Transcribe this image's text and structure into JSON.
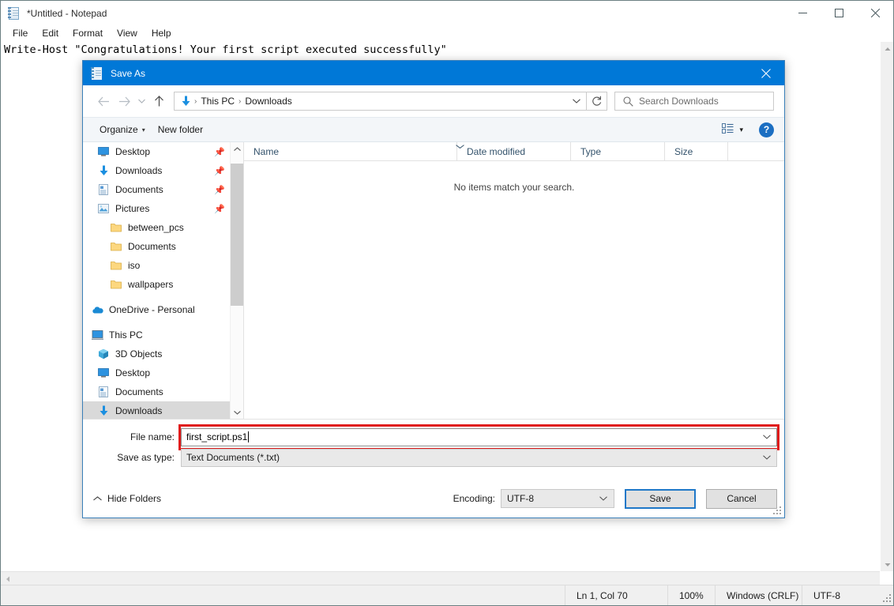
{
  "notepad": {
    "title": "*Untitled - Notepad",
    "icon": "notepad-icon",
    "window_controls": {
      "minimize": "minimize-icon",
      "maximize": "maximize-icon",
      "close": "close-icon"
    },
    "menu": [
      {
        "label": "File"
      },
      {
        "label": "Edit"
      },
      {
        "label": "Format"
      },
      {
        "label": "View"
      },
      {
        "label": "Help"
      }
    ],
    "document_text": "Write-Host \"Congratulations! Your first script executed successfully\"",
    "statusbar": {
      "position": "Ln 1, Col 70",
      "zoom": "100%",
      "line_endings": "Windows (CRLF)",
      "encoding": "UTF-8"
    }
  },
  "dialog": {
    "title": "Save As",
    "title_icon": "notepad-icon",
    "close_label": "✕",
    "nav": {
      "back": "back-arrow-icon",
      "forward": "forward-arrow-icon",
      "recent": "chevron-down-icon",
      "up": "up-arrow-icon",
      "address_icon": "downloads-arrow-icon",
      "breadcrumbs": [
        "This PC",
        "Downloads"
      ],
      "separator": "›",
      "dropdown": "chevron-down-icon",
      "refresh": "refresh-icon",
      "search_icon": "search-icon",
      "search_placeholder": "Search Downloads"
    },
    "toolbar": {
      "organize": "Organize",
      "organize_caret": "▾",
      "new_folder": "New folder",
      "view_icon": "view-list-icon",
      "view_caret": "▾",
      "help": "?"
    },
    "nav_pane": {
      "quick_access": [
        {
          "label": "Desktop",
          "icon": "desktop-icon",
          "pinned": true,
          "indent": 1
        },
        {
          "label": "Downloads",
          "icon": "downloads-arrow-icon",
          "pinned": true,
          "indent": 1
        },
        {
          "label": "Documents",
          "icon": "documents-icon",
          "pinned": true,
          "indent": 1
        },
        {
          "label": "Pictures",
          "icon": "pictures-icon",
          "pinned": true,
          "indent": 1
        },
        {
          "label": "between_pcs",
          "icon": "folder-icon",
          "pinned": false,
          "indent": 1
        },
        {
          "label": "Documents",
          "icon": "folder-icon",
          "pinned": false,
          "indent": 1
        },
        {
          "label": "iso",
          "icon": "folder-icon",
          "pinned": false,
          "indent": 1
        },
        {
          "label": "wallpapers",
          "icon": "folder-icon",
          "pinned": false,
          "indent": 1
        }
      ],
      "onedrive": {
        "label": "OneDrive - Personal",
        "icon": "onedrive-cloud-icon",
        "indent": 0
      },
      "this_pc": {
        "label": "This PC",
        "icon": "this-pc-icon",
        "indent": 0
      },
      "this_pc_children": [
        {
          "label": "3D Objects",
          "icon": "3d-objects-icon",
          "selected": false
        },
        {
          "label": "Desktop",
          "icon": "desktop-icon",
          "selected": false
        },
        {
          "label": "Documents",
          "icon": "documents-icon",
          "selected": false
        },
        {
          "label": "Downloads",
          "icon": "downloads-arrow-icon",
          "selected": true
        }
      ]
    },
    "file_list": {
      "columns": [
        {
          "key": "name",
          "label": "Name"
        },
        {
          "key": "date",
          "label": "Date modified"
        },
        {
          "key": "type",
          "label": "Type"
        },
        {
          "key": "size",
          "label": "Size"
        }
      ],
      "sort_indicator": "chevron-up-icon",
      "rows": [],
      "empty_message": "No items match your search."
    },
    "form": {
      "filename_label": "File name:",
      "filename_value": "first_script.ps1",
      "filename_caret": "chevron-down-icon",
      "filetype_label": "Save as type:",
      "filetype_value": "Text Documents (*.txt)",
      "filetype_caret": "chevron-down-icon"
    },
    "actions": {
      "hide_folders": "Hide Folders",
      "hide_folders_chevron": "chevron-up-icon",
      "encoding_label": "Encoding:",
      "encoding_value": "UTF-8",
      "encoding_caret": "chevron-down-icon",
      "save": "Save",
      "cancel": "Cancel"
    },
    "resize_grip": "resize-grip-icon"
  },
  "colors": {
    "dialog_titlebar": "#0078d7",
    "highlight_box": "#e01b1b",
    "primary_button_border": "#1f78c8",
    "selection": "#d9d9d9",
    "help_blue": "#1b6ec2"
  }
}
